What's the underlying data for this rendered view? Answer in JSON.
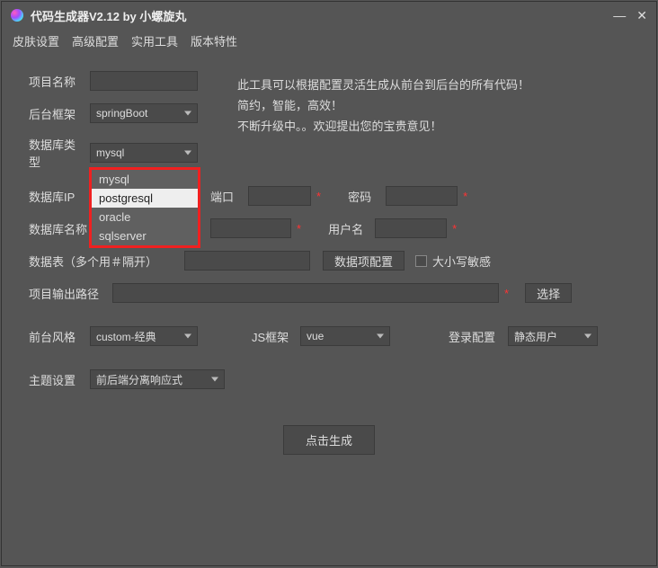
{
  "window": {
    "title": "代码生成器V2.12 by 小螺旋丸"
  },
  "menu": {
    "items": [
      "皮肤设置",
      "高级配置",
      "实用工具",
      "版本特性"
    ]
  },
  "intro": {
    "line1": "此工具可以根据配置灵活生成从前台到后台的所有代码！",
    "line2": "简约，智能，高效！",
    "line3": "不断升级中。。欢迎提出您的宝贵意见！"
  },
  "labels": {
    "projectName": "项目名称",
    "backendFramework": "后台框架",
    "dbType": "数据库类型",
    "dbIP": "数据库IP",
    "port": "端口",
    "password": "密码",
    "dbName": "数据库名称",
    "username": "用户名",
    "dataTable": "数据表（多个用＃隔开）",
    "dataConfig": "数据项配置",
    "caseSensitive": "大小写敏感",
    "outputPath": "项目输出路径",
    "choose": "选择",
    "frontStyle": "前台风格",
    "jsFramework": "JS框架",
    "loginConfig": "登录配置",
    "themeSetting": "主题设置",
    "generate": "点击生成"
  },
  "values": {
    "backendFramework": "springBoot",
    "dbType": "mysql",
    "frontStyle": "custom-经典",
    "jsFramework": "vue",
    "loginConfig": "静态用户",
    "themeSetting": "前后端分离响应式",
    "dbNamePartial": "("
  },
  "dropdown": {
    "items": [
      "mysql",
      "postgresql",
      "oracle",
      "sqlserver"
    ],
    "selectedIndex": 1
  }
}
